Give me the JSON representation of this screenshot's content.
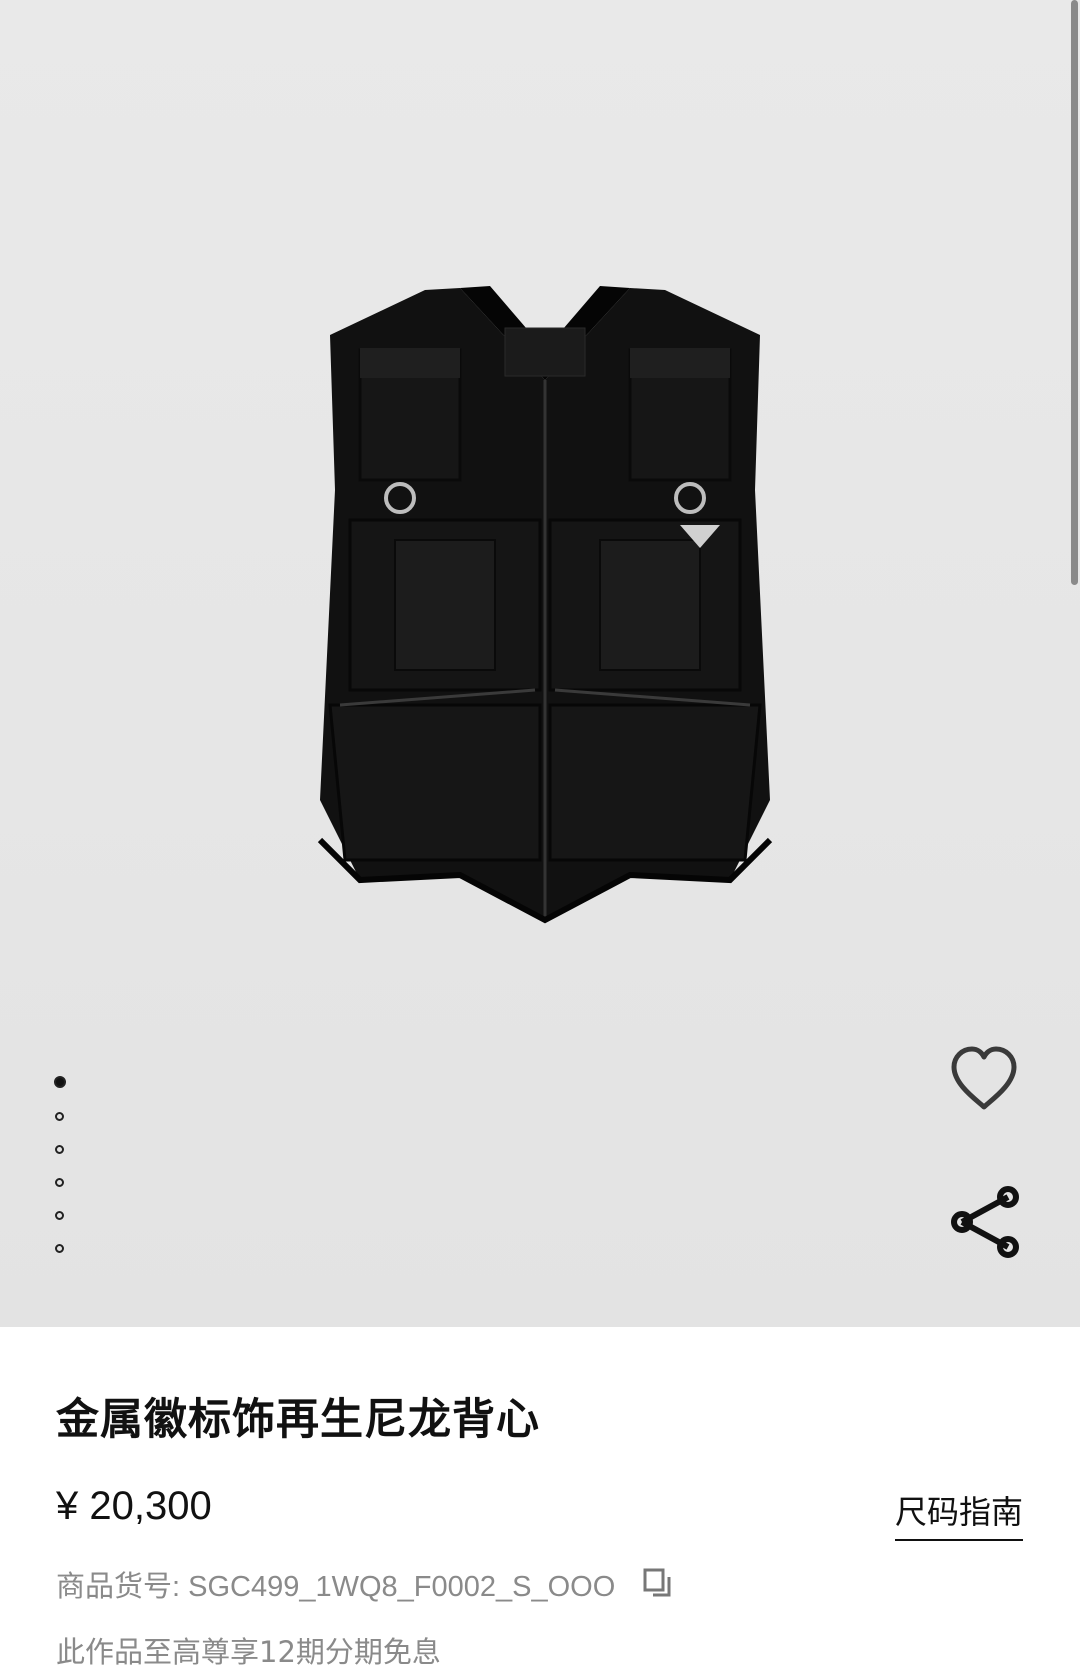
{
  "gallery": {
    "image_alt": "black nylon utility vest with multiple pockets",
    "dots_total": 6,
    "active_index": 0,
    "wishlist_icon": "heart-outline-icon",
    "share_icon": "share-icon"
  },
  "product": {
    "title": "金属徽标饰再生尼龙背心",
    "price": "¥ 20,300",
    "size_guide_label": "尺码指南",
    "sku_label": "商品货号: SGC499_1WQ8_F0002_S_OOO",
    "copy_icon": "copy-icon",
    "installment_text": "此作品至高尊享12期分期免息"
  }
}
